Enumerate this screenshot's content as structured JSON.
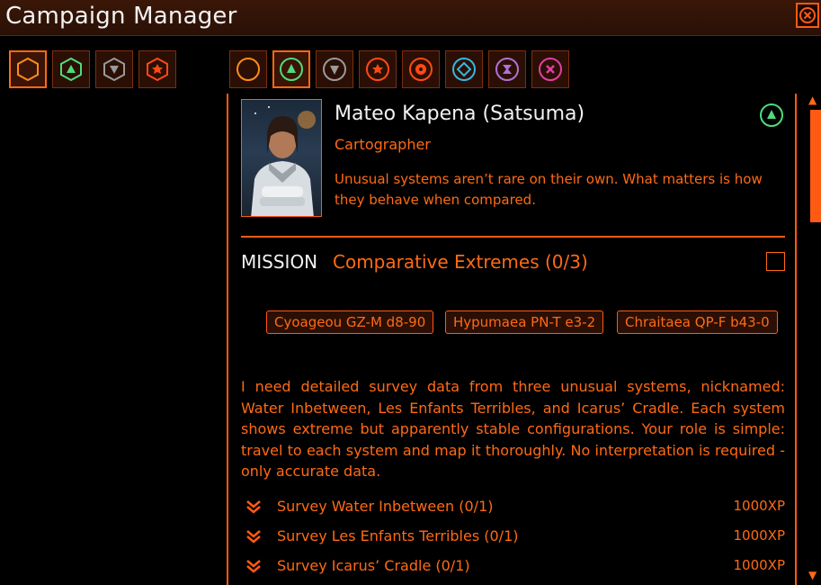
{
  "window": {
    "title": "Campaign Manager",
    "close_icon": "close-x-circle-icon"
  },
  "left_filters": [
    {
      "icon": "hexagon-outline-icon",
      "selected": true,
      "color": "#ff8c1a"
    },
    {
      "icon": "hexagon-triangle-up-icon",
      "selected": false,
      "color": "#4ddc7a"
    },
    {
      "icon": "hexagon-triangle-down-icon",
      "selected": false,
      "color": "#9a9a9a"
    },
    {
      "icon": "hexagon-star-icon",
      "selected": false,
      "color": "#ff4a14"
    }
  ],
  "role_filters": [
    {
      "icon": "circle-outline-icon",
      "selected": false,
      "color": "#ff8c1a"
    },
    {
      "icon": "circle-triangle-up-icon",
      "selected": true,
      "color": "#4ddc7a"
    },
    {
      "icon": "circle-triangle-down-icon",
      "selected": false,
      "color": "#9a9a9a"
    },
    {
      "icon": "circle-star-icon",
      "selected": false,
      "color": "#ff4a14"
    },
    {
      "icon": "circle-gear-icon",
      "selected": false,
      "color": "#ff4a14"
    },
    {
      "icon": "circle-diamond-icon",
      "selected": false,
      "color": "#34b8e0"
    },
    {
      "icon": "circle-hourglass-icon",
      "selected": false,
      "color": "#b070d8"
    },
    {
      "icon": "circle-cross-icon",
      "selected": false,
      "color": "#e040a0"
    }
  ],
  "contact": {
    "name": "Mateo Kapena (Satsuma)",
    "role": "Cartographer",
    "quote": "Unusual systems aren’t rare on their own. What matters is how they behave when compared.",
    "role_icon": "circle-triangle-up-icon"
  },
  "mission": {
    "label": "MISSION",
    "name": "Comparative Extremes (0/3)",
    "systems": [
      "Cyoageou GZ-M d8-90",
      "Hypumaea PN-T e3-2",
      "Chraitaea QP-F b43-0"
    ],
    "description": "I need detailed survey data from three unusual systems, nicknamed: Water Inbetween, Les Enfants Terribles, and Icarus’ Cradle. Each system shows extreme but apparently stable configurations. Your role is simple: travel to each system and map it thoroughly. No interpretation is required - only accurate data.",
    "tasks": [
      {
        "label": "Survey Water Inbetween (0/1)",
        "xp": "1000XP"
      },
      {
        "label": "Survey Les Enfants Terribles (0/1)",
        "xp": "1000XP"
      },
      {
        "label": "Survey Icarus’ Cradle (0/1)",
        "xp": "1000XP"
      }
    ]
  },
  "scrollbar": {
    "up_icon": "▲",
    "down_icon": "▼"
  }
}
